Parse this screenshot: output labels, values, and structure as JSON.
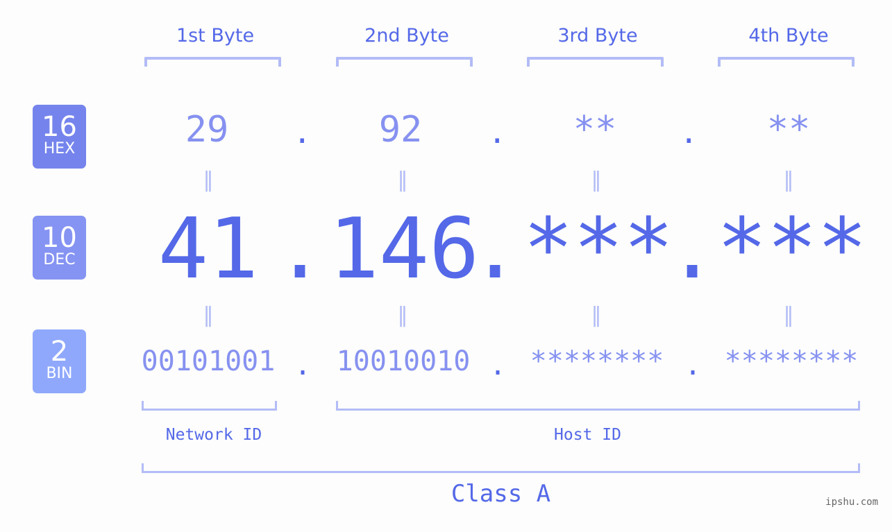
{
  "bytes": {
    "headers": [
      "1st Byte",
      "2nd Byte",
      "3rd Byte",
      "4th Byte"
    ]
  },
  "bases": {
    "hex": {
      "number": "16",
      "label": "HEX",
      "color": "#7584ec"
    },
    "dec": {
      "number": "10",
      "label": "DEC",
      "color": "#8593f2"
    },
    "bin": {
      "number": "2",
      "label": "BIN",
      "color": "#8fa8fb"
    }
  },
  "values": {
    "hex": [
      "29",
      "92",
      "**",
      "**"
    ],
    "dec": [
      "41",
      "146",
      "***",
      "***"
    ],
    "bin": [
      "00101001",
      "10010010",
      "********",
      "********"
    ],
    "separator": ".",
    "equals": "="
  },
  "segments": {
    "network_label": "Network ID",
    "host_label": "Host ID",
    "class_label": "Class A"
  },
  "watermark": "ipshu.com",
  "colors": {
    "accent": "#5468e8",
    "light_value": "#8691f0",
    "bracket": "#b3bcf7"
  }
}
